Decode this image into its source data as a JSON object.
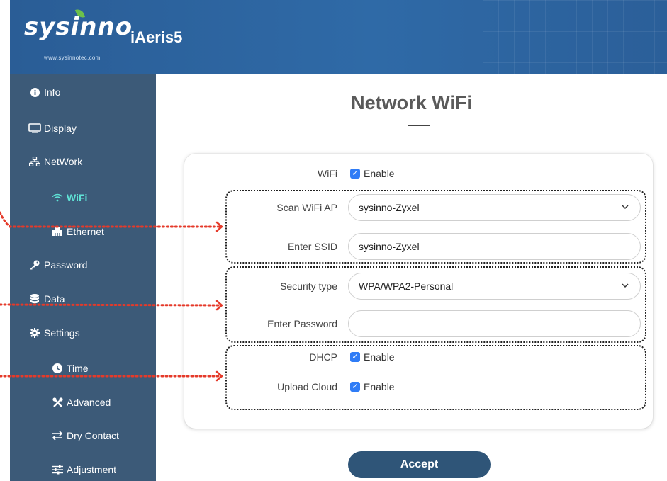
{
  "header": {
    "logo_text": "sysinno",
    "product_name": "iAeris5",
    "url": "www.sysinnotec.com"
  },
  "sidebar": {
    "items": [
      {
        "label": "Info",
        "icon": "info-icon"
      },
      {
        "label": "Display",
        "icon": "monitor-icon"
      },
      {
        "label": "NetWork",
        "icon": "network-icon"
      },
      {
        "label": "WiFi",
        "icon": "wifi-icon",
        "active": true
      },
      {
        "label": "Ethernet",
        "icon": "ethernet-icon"
      },
      {
        "label": "Password",
        "icon": "key-icon"
      },
      {
        "label": "Data",
        "icon": "database-icon"
      },
      {
        "label": "Settings",
        "icon": "gear-icon"
      },
      {
        "label": "Time",
        "icon": "clock-icon"
      },
      {
        "label": "Advanced",
        "icon": "tools-icon"
      },
      {
        "label": "Dry Contact",
        "icon": "swap-icon"
      },
      {
        "label": "Adjustment",
        "icon": "sliders-icon"
      }
    ]
  },
  "main": {
    "title": "Network WiFi",
    "wifi": {
      "label": "WiFi",
      "check_label": "Enable",
      "checked": true
    },
    "scan_ap": {
      "label": "Scan WiFi AP",
      "value": "sysinno-Zyxel"
    },
    "ssid": {
      "label": "Enter SSID",
      "value": "sysinno-Zyxel"
    },
    "security": {
      "label": "Security type",
      "value": "WPA/WPA2-Personal"
    },
    "password": {
      "label": "Enter Password",
      "value": ""
    },
    "dhcp": {
      "label": "DHCP",
      "check_label": "Enable",
      "checked": true
    },
    "upload_cloud": {
      "label": "Upload Cloud",
      "check_label": "Enable",
      "checked": true
    },
    "accept_label": "Accept"
  },
  "colors": {
    "header": "#2f6aa7",
    "sidebar": "#3c5a78",
    "active_item": "#5fe3d6",
    "checkbox": "#2f7cf6",
    "button": "#2f5578",
    "annotation_arrow": "#e53a2a"
  }
}
